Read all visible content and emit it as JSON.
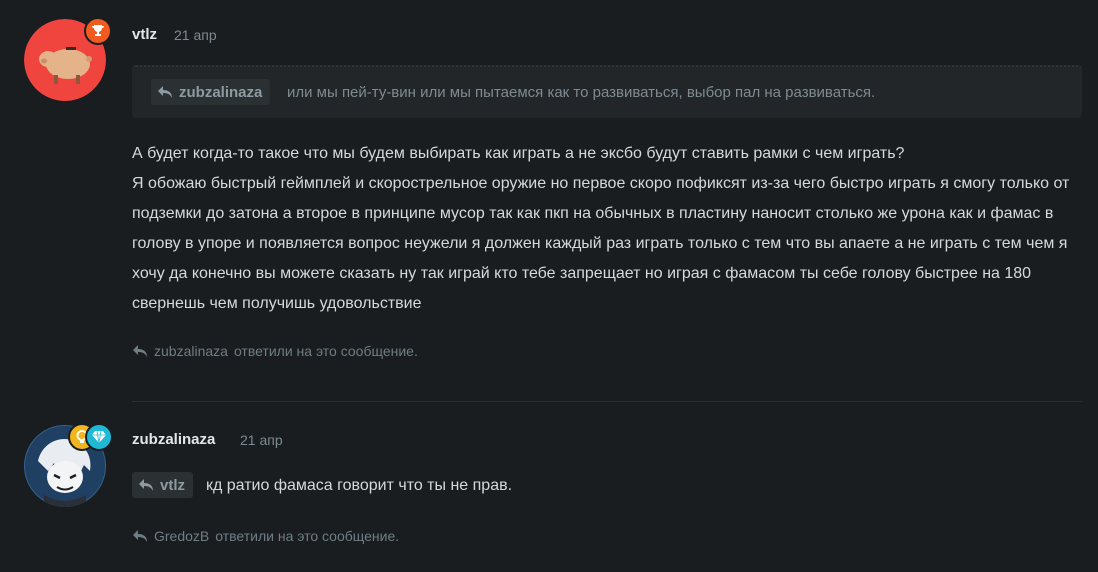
{
  "posts": [
    {
      "author": "vtlz",
      "date": "21 апр",
      "quote": {
        "username": "zubzalinaza",
        "text": "или мы пей-ту-вин или мы пытаемся как то развиваться, выбор пал на развиваться."
      },
      "body": [
        "А будет когда-то такое что мы будем выбирать как играть а не эксбо будут ставить рамки с чем играть?",
        "Я обожаю быстрый геймплей и скорострельное оружие но первое скоро пофиксят из-за чего быстро играть я смогу только от подземки до затона а второе в принципе мусор так как пкп на обычных в пластину наносит столько же урона как и фамас в голову в упоре и появляется вопрос неужели я должен каждый раз играть только с тем что вы апаете а не играть с тем чем я хочу да конечно вы можете сказать ну так играй кто тебе запрещает но играя с фамасом ты себе голову быстрее на 180 свернешь чем получишь удовольствие"
      ],
      "replied_by": "zubzalinaza",
      "replied_suffix": "ответили на это сообщение.",
      "badge_icon": "trophy-icon",
      "colors": {
        "avatar_bg": "#f0453f",
        "badge_bg": "#f25a1e"
      }
    },
    {
      "author": "zubzalinaza",
      "date": "21 апр",
      "reply_to": "vtlz",
      "text": "кд ратио фамаса говорит что ты не прав.",
      "replied_by": "GredozB",
      "replied_suffix": "ответили на это сообщение.",
      "badge_icons": [
        "bulb-icon",
        "diamond-icon"
      ],
      "colors": {
        "avatar_bg": "#1f3f63",
        "badge1_bg": "#f2b51e",
        "badge2_bg": "#1fb9d6"
      }
    }
  ]
}
